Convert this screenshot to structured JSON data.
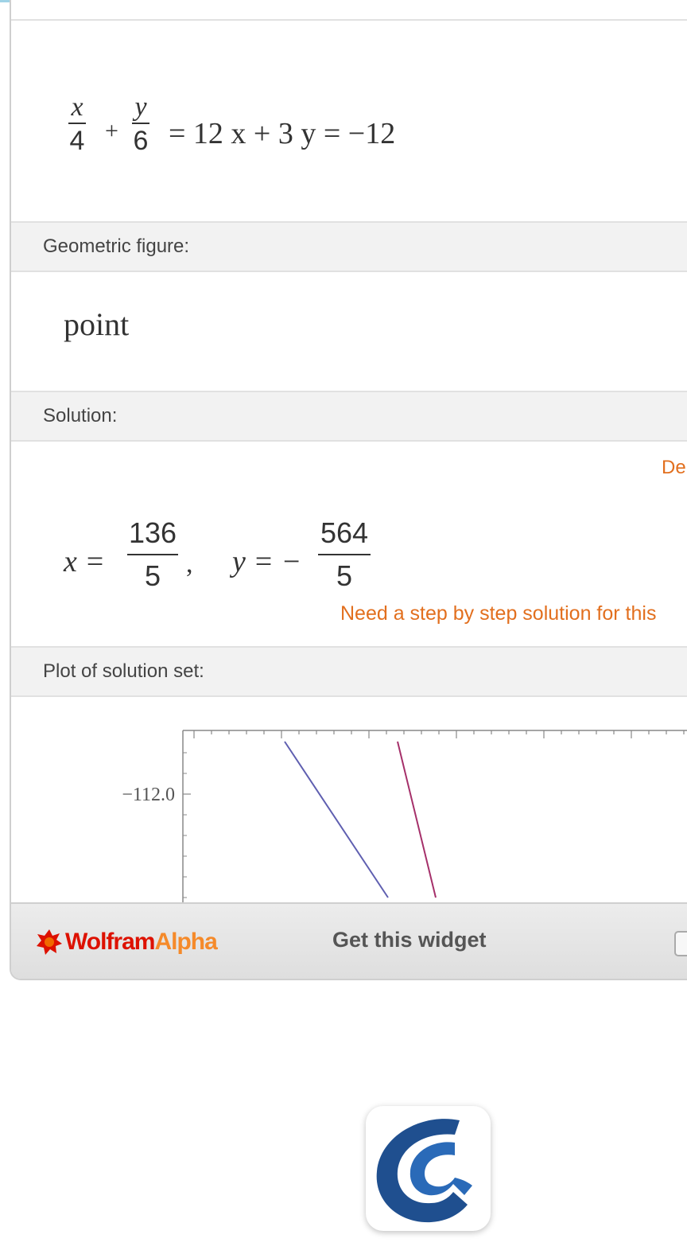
{
  "equation": {
    "frac1": {
      "num": "x",
      "den": "4"
    },
    "plus": "+",
    "frac2": {
      "num": "y",
      "den": "6"
    },
    "rest": "= 12 x + 3 y = −12"
  },
  "geometric_figure": {
    "header": "Geometric figure:",
    "value": "point"
  },
  "solution": {
    "header": "Solution:",
    "details_link": "De",
    "x_label": "x =",
    "x_num": "136",
    "x_den": "5",
    "comma": ",",
    "y_label": "y = −",
    "y_num": "564",
    "y_den": "5",
    "step_link": "Need a step by step solution for this"
  },
  "plot": {
    "header": "Plot of solution set:",
    "ytick_label": "−112.0",
    "line1_color": "#5f5fb0",
    "line2_color": "#a5306a"
  },
  "footer": {
    "logo_wolfram": "Wolfram",
    "logo_alpha": "Alpha",
    "get_widget": "Get this widget"
  },
  "app_icon": {
    "name": "brainly-c-logo-icon"
  }
}
